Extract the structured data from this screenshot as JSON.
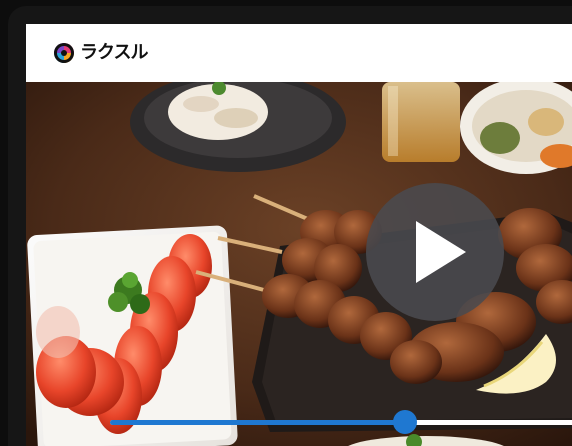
{
  "brand": {
    "logo_text": "ラクスル"
  },
  "player": {
    "play_icon": "play-icon",
    "progress": 0.62,
    "accent_color": "#1f78d1"
  }
}
